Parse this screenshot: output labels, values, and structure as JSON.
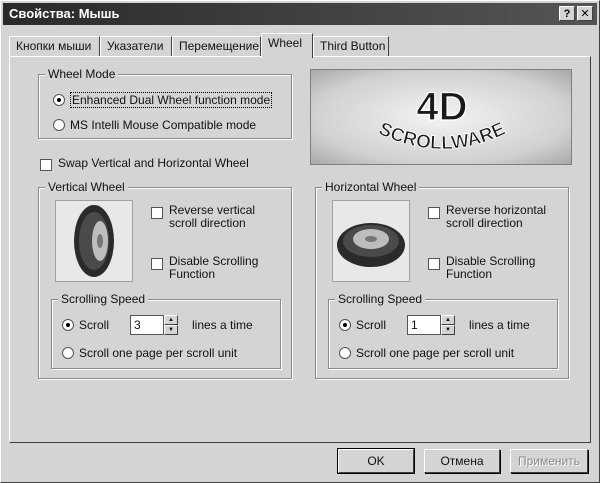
{
  "window": {
    "title": "Свойства: Мышь",
    "help_btn": "?",
    "close_btn": "✕"
  },
  "tabs": [
    {
      "label": "Кнопки мыши"
    },
    {
      "label": "Указатели"
    },
    {
      "label": "Перемещение"
    },
    {
      "label": "Wheel"
    },
    {
      "label": "Third Button"
    }
  ],
  "active_tab": "Wheel",
  "wheel_mode": {
    "legend": "Wheel Mode",
    "options": [
      {
        "label": "Enhanced Dual Wheel function mode",
        "selected": true
      },
      {
        "label": "MS Intelli Mouse Compatible mode",
        "selected": false
      }
    ]
  },
  "logo": {
    "line1": "4D",
    "line2": "SCROLLWARE"
  },
  "swap_option": {
    "label": "Swap Vertical and Horizontal Wheel",
    "checked": false
  },
  "vertical": {
    "legend": "Vertical Wheel",
    "reverse_l1": "Reverse vertical",
    "reverse_l2": "scroll direction",
    "disable_l1": "Disable Scrolling",
    "disable_l2": "Function",
    "speed_legend": "Scrolling Speed",
    "scroll_label": "Scroll",
    "scroll_value": "3",
    "lines_label": "lines a time",
    "page_label": "Scroll one page per scroll unit"
  },
  "horizontal": {
    "legend": "Horizontal Wheel",
    "reverse_l1": "Reverse horizontal",
    "reverse_l2": "scroll direction",
    "disable_l1": "Disable Scrolling",
    "disable_l2": "Function",
    "speed_legend": "Scrolling Speed",
    "scroll_label": "Scroll",
    "scroll_value": "1",
    "lines_label": "lines a time",
    "page_label": "Scroll one page per scroll unit"
  },
  "buttons": {
    "ok": "OK",
    "cancel": "Отмена",
    "apply": "Применить"
  }
}
